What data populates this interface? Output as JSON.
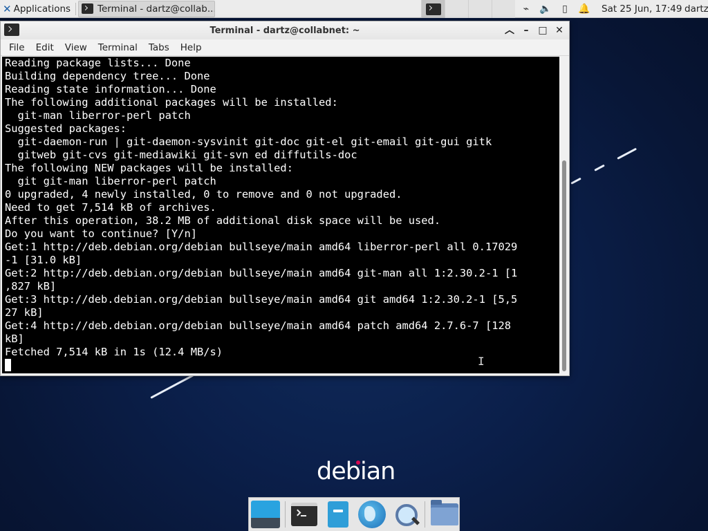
{
  "top_panel": {
    "applications_label": "Applications",
    "task_button_title": "Terminal - dartz@collab...",
    "clock": "Sat 25 Jun, 17:49",
    "user": "dartz",
    "tray_icons": [
      "network-icon",
      "volume-icon",
      "battery-icon",
      "notification-bell-icon"
    ]
  },
  "window": {
    "title": "Terminal - dartz@collabnet: ~",
    "controls": [
      "shade-button",
      "minimize-button",
      "maximize-button",
      "close-button"
    ],
    "menu": [
      "File",
      "Edit",
      "View",
      "Terminal",
      "Tabs",
      "Help"
    ]
  },
  "terminal": {
    "lines": [
      "Reading package lists... Done",
      "Building dependency tree... Done",
      "Reading state information... Done",
      "The following additional packages will be installed:",
      "  git-man liberror-perl patch",
      "Suggested packages:",
      "  git-daemon-run | git-daemon-sysvinit git-doc git-el git-email git-gui gitk",
      "  gitweb git-cvs git-mediawiki git-svn ed diffutils-doc",
      "The following NEW packages will be installed:",
      "  git git-man liberror-perl patch",
      "0 upgraded, 4 newly installed, 0 to remove and 0 not upgraded.",
      "Need to get 7,514 kB of archives.",
      "After this operation, 38.2 MB of additional disk space will be used.",
      "Do you want to continue? [Y/n]",
      "Get:1 http://deb.debian.org/debian bullseye/main amd64 liberror-perl all 0.17029",
      "-1 [31.0 kB]",
      "Get:2 http://deb.debian.org/debian bullseye/main amd64 git-man all 1:2.30.2-1 [1",
      ",827 kB]",
      "Get:3 http://deb.debian.org/debian bullseye/main amd64 git amd64 1:2.30.2-1 [5,5",
      "27 kB]",
      "Get:4 http://deb.debian.org/debian bullseye/main amd64 patch amd64 2.7.6-7 [128",
      "kB]",
      "Fetched 7,514 kB in 1s (12.4 MB/s)"
    ]
  },
  "wallpaper": {
    "logo_text": "debian",
    "accent_color": "#d70751"
  },
  "dock": {
    "items": [
      "show-desktop-icon",
      "terminal-icon",
      "file-manager-icon",
      "web-browser-icon",
      "app-finder-icon",
      "home-folder-icon"
    ]
  }
}
